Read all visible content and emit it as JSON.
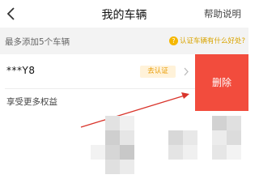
{
  "nav": {
    "title": "我的车辆",
    "help": "帮助说明"
  },
  "info": {
    "max_note": "最多添加5个车辆",
    "verify_tip": "认证车辆有什么好处?"
  },
  "vehicle": {
    "plate": "***Y8",
    "verify_badge": "去认证",
    "benefits": "享受更多权益"
  },
  "actions": {
    "delete": "删除"
  },
  "colors": {
    "accent_orange": "#e89b00",
    "delete_red": "#f24c3d",
    "annotation_arrow": "#d9342b"
  }
}
